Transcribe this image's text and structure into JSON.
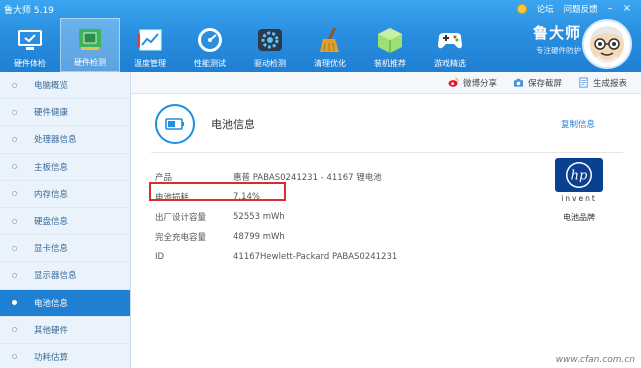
{
  "window": {
    "title": "鲁大师 5.19",
    "top_links": [
      "论坛",
      "问题反馈"
    ],
    "minimize": "–",
    "close": "×"
  },
  "tabs": [
    {
      "label": "硬件体检",
      "icon": "monitor-check-icon"
    },
    {
      "label": "硬件检测",
      "icon": "chip-icon"
    },
    {
      "label": "温度管理",
      "icon": "thermometer-chart-icon"
    },
    {
      "label": "性能测试",
      "icon": "speedometer-icon"
    },
    {
      "label": "驱动检测",
      "icon": "gear-box-icon"
    },
    {
      "label": "清理优化",
      "icon": "broom-icon"
    },
    {
      "label": "装机推荐",
      "icon": "cube-icon"
    },
    {
      "label": "游戏精选",
      "icon": "gamepad-icon"
    }
  ],
  "active_tab": 1,
  "brand": {
    "name": "鲁大师",
    "slogan": "专注硬件防护"
  },
  "toolbar": {
    "share": "微博分享",
    "save": "保存截屏",
    "report": "生成报表"
  },
  "sidebar": {
    "items": [
      "电脑概览",
      "硬件健康",
      "处理器信息",
      "主板信息",
      "内存信息",
      "硬盘信息",
      "显卡信息",
      "显示器信息",
      "电池信息",
      "其他硬件",
      "功耗估算"
    ],
    "active_index": 8
  },
  "section": {
    "title": "电池信息",
    "copy_label": "复制信息"
  },
  "battery_info": [
    {
      "key": "产品",
      "value": "惠普 PABAS0241231 - 41167 锂电池"
    },
    {
      "key": "电池损耗",
      "value": "7.14%"
    },
    {
      "key": "出厂设计容量",
      "value": "52553 mWh"
    },
    {
      "key": "完全充电容量",
      "value": "48799 mWh"
    },
    {
      "key": "ID",
      "value": "41167Hewlett-Packard PABAS0241231"
    }
  ],
  "brand_logo": {
    "mark": "hp",
    "tagline": "invent",
    "caption": "电池品牌"
  },
  "watermark": "www.cfan.com.cn",
  "colors": {
    "header_blue": "#2a8fe0",
    "active_blue": "#1f7fd3",
    "highlight_red": "#d42e2e",
    "hp_blue": "#0b3f8f"
  }
}
